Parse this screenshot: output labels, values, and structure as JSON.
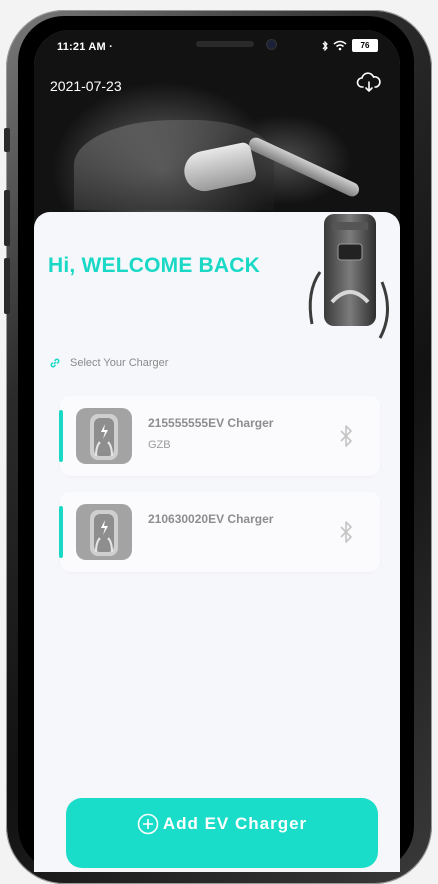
{
  "status_bar": {
    "time": "11:21 AM",
    "battery": "76"
  },
  "header": {
    "date": "2021-07-23"
  },
  "welcome": {
    "title": "Hi, WELCOME BACK"
  },
  "select_label": "Select Your Charger",
  "chargers": [
    {
      "name": "215555555EV Charger",
      "subtitle": "GZB"
    },
    {
      "name": "210630020EV Charger",
      "subtitle": ""
    }
  ],
  "add_button": {
    "label": "Add EV Charger"
  },
  "colors": {
    "accent": "#19d9c6",
    "button": "#19dcc9",
    "text_muted": "#8d8d8d"
  },
  "icons": {
    "cloud": "cloud-download-icon",
    "link": "link-icon",
    "charger": "charger-icon",
    "bluetooth": "bluetooth-icon",
    "plus": "plus-circle-icon"
  }
}
